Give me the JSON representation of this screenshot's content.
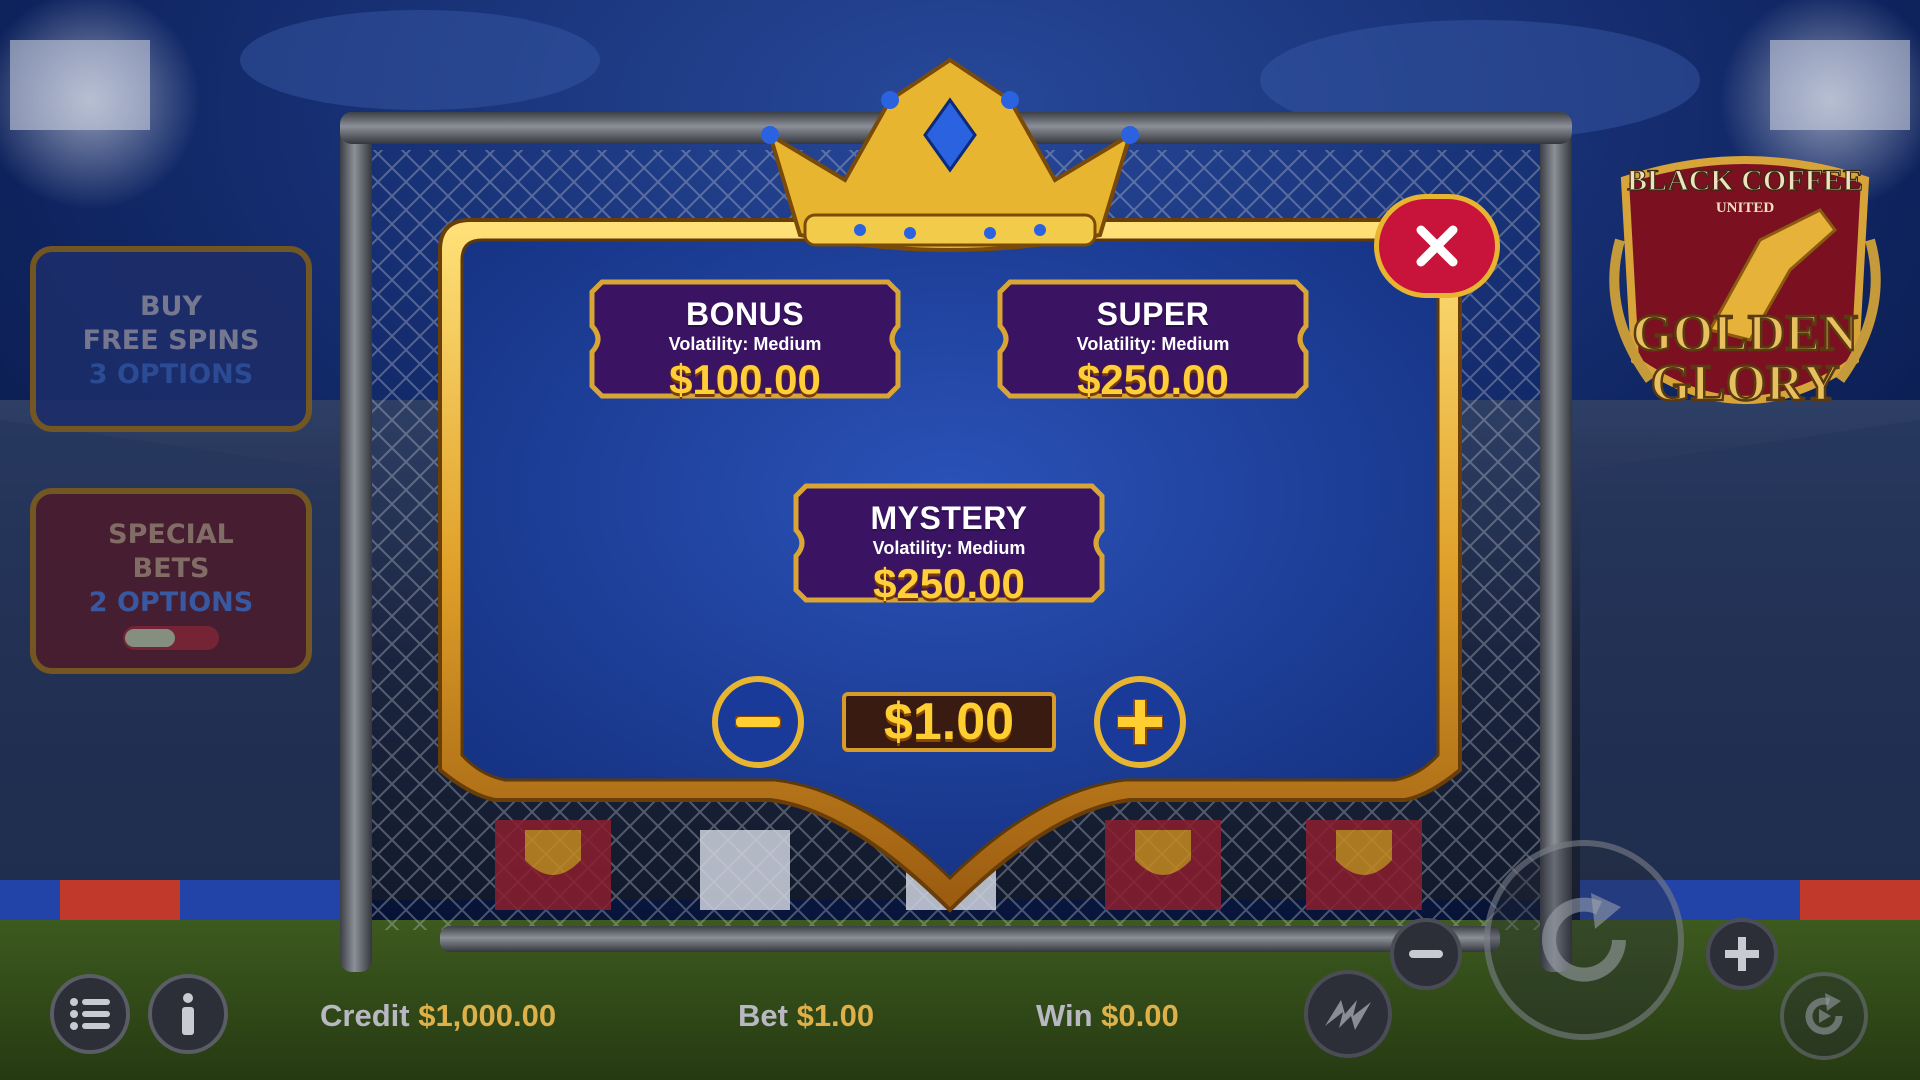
{
  "game": {
    "logo_lines": [
      "BLACK COFFEE",
      "UNITED",
      "GOLDEN",
      "GLORY"
    ]
  },
  "left_panels": {
    "buy_free_spins": {
      "line1": "BUY",
      "line2": "FREE SPINS",
      "line3": "3 OPTIONS"
    },
    "special_bets": {
      "line1": "SPECIAL",
      "line2": "BETS",
      "line3": "2 OPTIONS",
      "toggle_on": false
    }
  },
  "popup": {
    "close_icon": "close-icon",
    "options": [
      {
        "title": "BONUS",
        "volatility": "Volatility: Medium",
        "price": "$100.00"
      },
      {
        "title": "SUPER",
        "volatility": "Volatility: Medium",
        "price": "$250.00"
      },
      {
        "title": "MYSTERY",
        "volatility": "Volatility: Medium",
        "price": "$250.00"
      }
    ],
    "stake": "$1.00",
    "minus_icon": "minus-icon",
    "plus_icon": "plus-icon"
  },
  "bottom_bar": {
    "credit_label": "Credit",
    "credit_value": "$1,000.00",
    "bet_label": "Bet",
    "bet_value": "$1.00",
    "win_label": "Win",
    "win_value": "$0.00",
    "icons": [
      "menu-icon",
      "info-icon",
      "turbo-icon",
      "bet-minus-icon",
      "spin-icon",
      "bet-plus-icon",
      "autoplay-icon"
    ]
  },
  "colors": {
    "gold": "#e8b531",
    "blue_panel": "#1f3d9a",
    "purple_card": "#3a1463",
    "close_red": "#c8143a"
  }
}
